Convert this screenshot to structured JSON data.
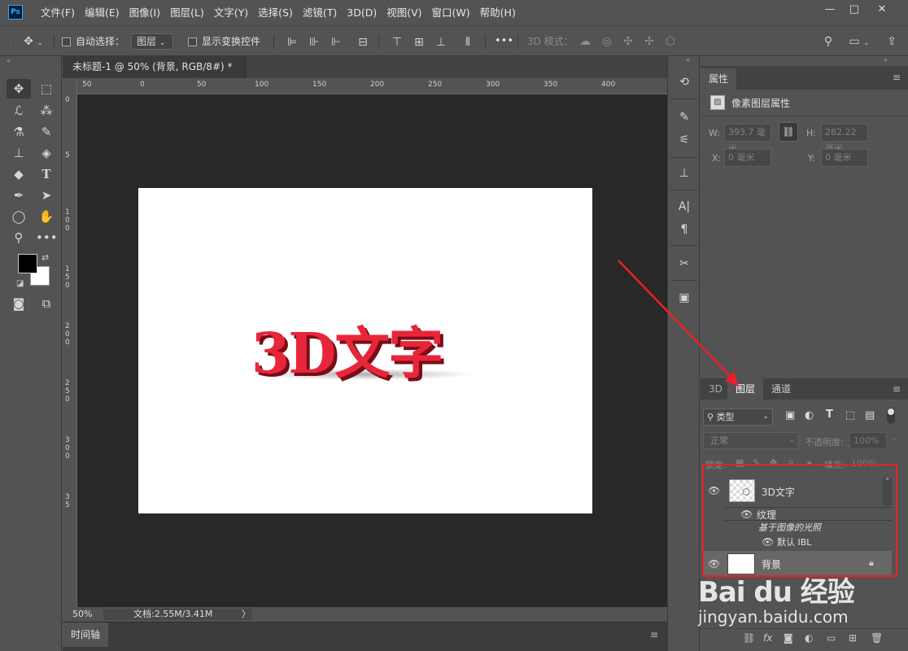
{
  "app": {
    "logo": "Ps",
    "menu": [
      "文件(F)",
      "编辑(E)",
      "图像(I)",
      "图层(L)",
      "文字(Y)",
      "选择(S)",
      "滤镜(T)",
      "3D(D)",
      "视图(V)",
      "窗口(W)",
      "帮助(H)"
    ],
    "window_controls": {
      "minimize": "—",
      "maximize": "□",
      "close": "✕"
    }
  },
  "options_bar": {
    "auto_select_label": "自动选择：",
    "auto_select_value": "图层",
    "show_transform_label": "显示变换控件",
    "mode_3d_label": "3D 模式：",
    "more": "•••"
  },
  "document": {
    "tab_title": "未标题-1 @ 50% (背景, RGB/8#) *",
    "tab_close": "×",
    "ruler_top": [
      "50",
      "0",
      "50",
      "100",
      "150",
      "200",
      "250",
      "300",
      "350",
      "400"
    ],
    "ruler_left": [
      "0",
      "5",
      "1 0 0",
      "1 5 0",
      "2 0 0",
      "2 5 0",
      "3 0 0",
      "3 5"
    ],
    "canvas_text": "3D文字",
    "zoom": "50%",
    "doc_size": "文档:2.55M/3.41M",
    "status_arrow": "〉"
  },
  "timeline": {
    "label": "时间轴"
  },
  "properties": {
    "tab": "属性",
    "header": "像素图层属性",
    "w_label": "W:",
    "w_value": "393.7 毫米",
    "h_label": "H:",
    "h_value": "282.22 毫米",
    "x_label": "X:",
    "x_value": "0 毫米",
    "y_label": "Y:",
    "y_value": "0 毫米"
  },
  "layers_panel": {
    "tabs": [
      "3D",
      "图层",
      "通道"
    ],
    "active_tab": "图层",
    "filter_kind": "类型",
    "blend_mode": "正常",
    "opacity_label": "不透明度:",
    "opacity_value": "100%",
    "lock_label": "锁定:",
    "fill_label": "填充:",
    "fill_value": "100%",
    "layers": [
      {
        "name": "3D文字",
        "kind": "3d"
      },
      {
        "name": "纹理",
        "kind": "sub"
      },
      {
        "name": "基于图像的光照",
        "kind": "sub-italic"
      },
      {
        "name": "默认 IBL",
        "kind": "sub2"
      },
      {
        "name": "背景",
        "kind": "background"
      }
    ]
  },
  "watermark": {
    "brand": "Bai du 经验",
    "url": "jingyan.baidu.com"
  },
  "colors": {
    "accent_red": "#e8202a",
    "text_red": "#e8263a",
    "panel_bg": "#535353",
    "canvas_bg": "#282828"
  }
}
